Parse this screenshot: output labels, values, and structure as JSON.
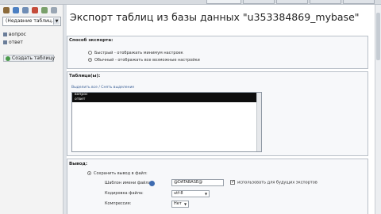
{
  "sidebar": {
    "db_select": "(Недавние таблиц...)",
    "items": [
      {
        "label": "вопрос"
      },
      {
        "label": "ответ"
      }
    ],
    "create_table": "Создать таблицу"
  },
  "main": {
    "title": "Экспорт таблиц из базы данных \"u353384869_mybase\"",
    "export_method": {
      "legend": "Способ экспорта:",
      "options": [
        {
          "label": "Быстрый - отображать минимум настроек",
          "selected": false
        },
        {
          "label": "Обычный - отображать все возможные настройки",
          "selected": true
        }
      ]
    },
    "tables": {
      "legend": "Таблица(ы):",
      "select_links": "Выделить все / Снять выделение",
      "rows": [
        "вопрос",
        "ответ"
      ]
    },
    "output": {
      "legend": "Вывод:",
      "save_to_file": "Сохранить вывод в файл:",
      "filename_template_label": "Шаблон имени файла:",
      "filename_template_value": "@DATABASE@",
      "use_for_future_label": "использовать для будущих экспортов",
      "encoding_label": "Кодировка файла:",
      "encoding_value": "utf-8",
      "compression_label": "Компрессия:",
      "compression_value": "Нет"
    }
  }
}
